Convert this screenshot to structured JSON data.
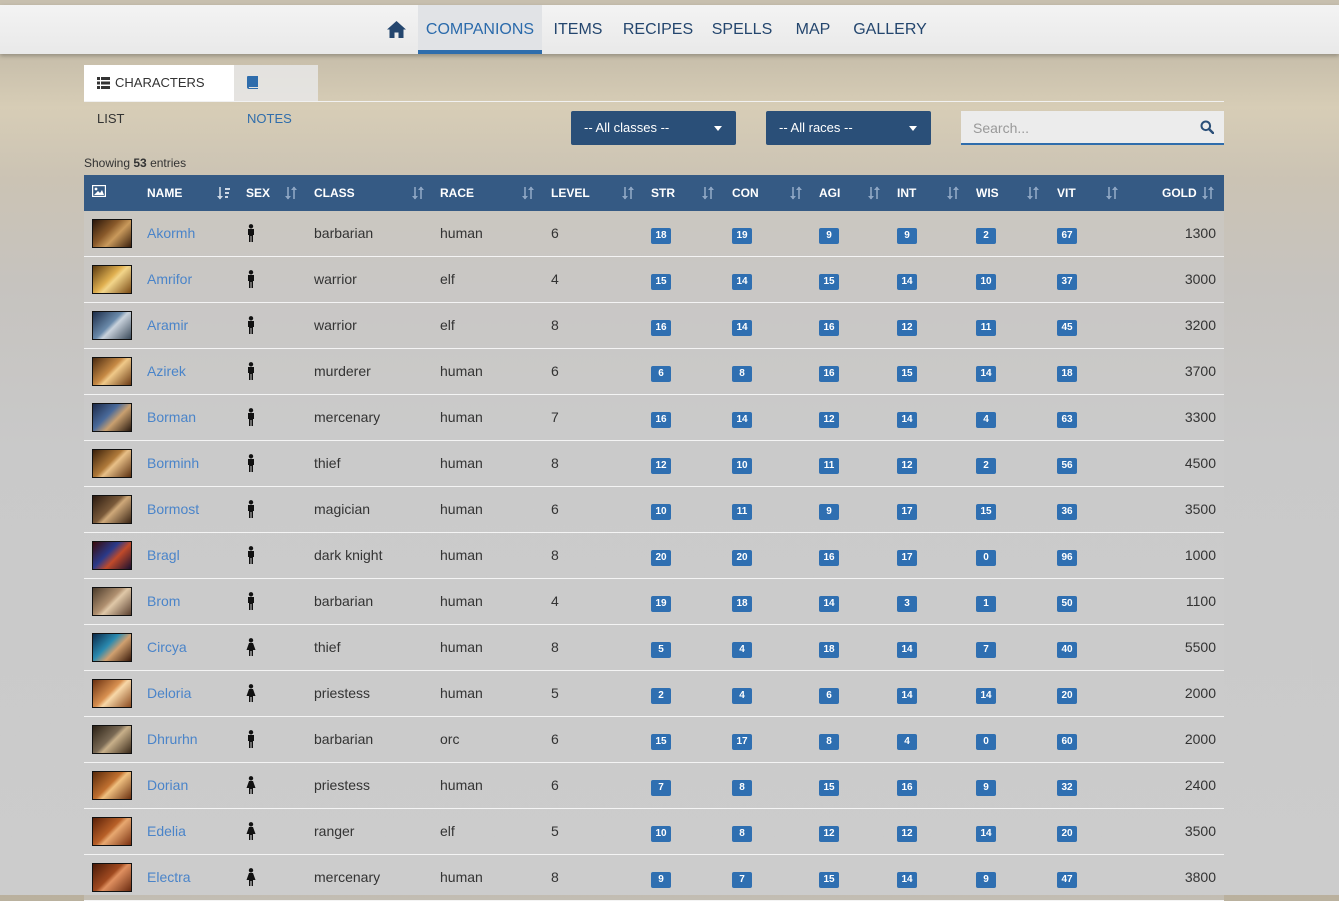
{
  "nav": {
    "home_icon": "home-icon",
    "items": [
      "COMPANIONS",
      "ITEMS",
      "RECIPES",
      "SPELLS",
      "MAP",
      "GALLERY"
    ],
    "active": "COMPANIONS"
  },
  "tabs": {
    "characters_list": "CHARACTERS LIST",
    "notes": "NOTES"
  },
  "filters": {
    "classes": "-- All classes --",
    "races": "-- All races --",
    "search_placeholder": "Search..."
  },
  "info": {
    "prefix": "Showing",
    "count": "53",
    "suffix": "entries"
  },
  "table": {
    "columns": [
      "NAME",
      "SEX",
      "CLASS",
      "RACE",
      "LEVEL",
      "STR",
      "CON",
      "AGI",
      "INT",
      "WIS",
      "VIT",
      "GOLD"
    ],
    "rows": [
      {
        "name": "Akormh",
        "sex": "male",
        "class": "barbarian",
        "race": "human",
        "level": "6",
        "str": "18",
        "con": "19",
        "agi": "9",
        "int": "9",
        "wis": "2",
        "vit": "67",
        "gold": "1300"
      },
      {
        "name": "Amrifor",
        "sex": "male",
        "class": "warrior",
        "race": "elf",
        "level": "4",
        "str": "15",
        "con": "14",
        "agi": "15",
        "int": "14",
        "wis": "10",
        "vit": "37",
        "gold": "3000"
      },
      {
        "name": "Aramir",
        "sex": "male",
        "class": "warrior",
        "race": "elf",
        "level": "8",
        "str": "16",
        "con": "14",
        "agi": "16",
        "int": "12",
        "wis": "11",
        "vit": "45",
        "gold": "3200"
      },
      {
        "name": "Azirek",
        "sex": "male",
        "class": "murderer",
        "race": "human",
        "level": "6",
        "str": "6",
        "con": "8",
        "agi": "16",
        "int": "15",
        "wis": "14",
        "vit": "18",
        "gold": "3700"
      },
      {
        "name": "Borman",
        "sex": "male",
        "class": "mercenary",
        "race": "human",
        "level": "7",
        "str": "16",
        "con": "14",
        "agi": "12",
        "int": "14",
        "wis": "4",
        "vit": "63",
        "gold": "3300"
      },
      {
        "name": "Borminh",
        "sex": "male",
        "class": "thief",
        "race": "human",
        "level": "8",
        "str": "12",
        "con": "10",
        "agi": "11",
        "int": "12",
        "wis": "2",
        "vit": "56",
        "gold": "4500"
      },
      {
        "name": "Bormost",
        "sex": "male",
        "class": "magician",
        "race": "human",
        "level": "6",
        "str": "10",
        "con": "11",
        "agi": "9",
        "int": "17",
        "wis": "15",
        "vit": "36",
        "gold": "3500"
      },
      {
        "name": "Bragl",
        "sex": "male",
        "class": "dark knight",
        "race": "human",
        "level": "8",
        "str": "20",
        "con": "20",
        "agi": "16",
        "int": "17",
        "wis": "0",
        "vit": "96",
        "gold": "1000"
      },
      {
        "name": "Brom",
        "sex": "male",
        "class": "barbarian",
        "race": "human",
        "level": "4",
        "str": "19",
        "con": "18",
        "agi": "14",
        "int": "3",
        "wis": "1",
        "vit": "50",
        "gold": "1100"
      },
      {
        "name": "Circya",
        "sex": "female",
        "class": "thief",
        "race": "human",
        "level": "8",
        "str": "5",
        "con": "4",
        "agi": "18",
        "int": "14",
        "wis": "7",
        "vit": "40",
        "gold": "5500"
      },
      {
        "name": "Deloria",
        "sex": "female",
        "class": "priestess",
        "race": "human",
        "level": "5",
        "str": "2",
        "con": "4",
        "agi": "6",
        "int": "14",
        "wis": "14",
        "vit": "20",
        "gold": "2000"
      },
      {
        "name": "Dhrurhn",
        "sex": "male",
        "class": "barbarian",
        "race": "orc",
        "level": "6",
        "str": "15",
        "con": "17",
        "agi": "8",
        "int": "4",
        "wis": "0",
        "vit": "60",
        "gold": "2000"
      },
      {
        "name": "Dorian",
        "sex": "female",
        "class": "priestess",
        "race": "human",
        "level": "6",
        "str": "7",
        "con": "8",
        "agi": "15",
        "int": "16",
        "wis": "9",
        "vit": "32",
        "gold": "2400"
      },
      {
        "name": "Edelia",
        "sex": "female",
        "class": "ranger",
        "race": "elf",
        "level": "5",
        "str": "10",
        "con": "8",
        "agi": "12",
        "int": "12",
        "wis": "14",
        "vit": "20",
        "gold": "3500"
      },
      {
        "name": "Electra",
        "sex": "female",
        "class": "mercenary",
        "race": "human",
        "level": "8",
        "str": "9",
        "con": "7",
        "agi": "15",
        "int": "14",
        "wis": "9",
        "vit": "47",
        "gold": "3800"
      }
    ]
  },
  "colors": {
    "nav_text": "#24466e",
    "accent": "#2f6dac",
    "header_bg": "#355a84",
    "badge_bg": "#2f6fb1",
    "link": "#4a84c9"
  }
}
